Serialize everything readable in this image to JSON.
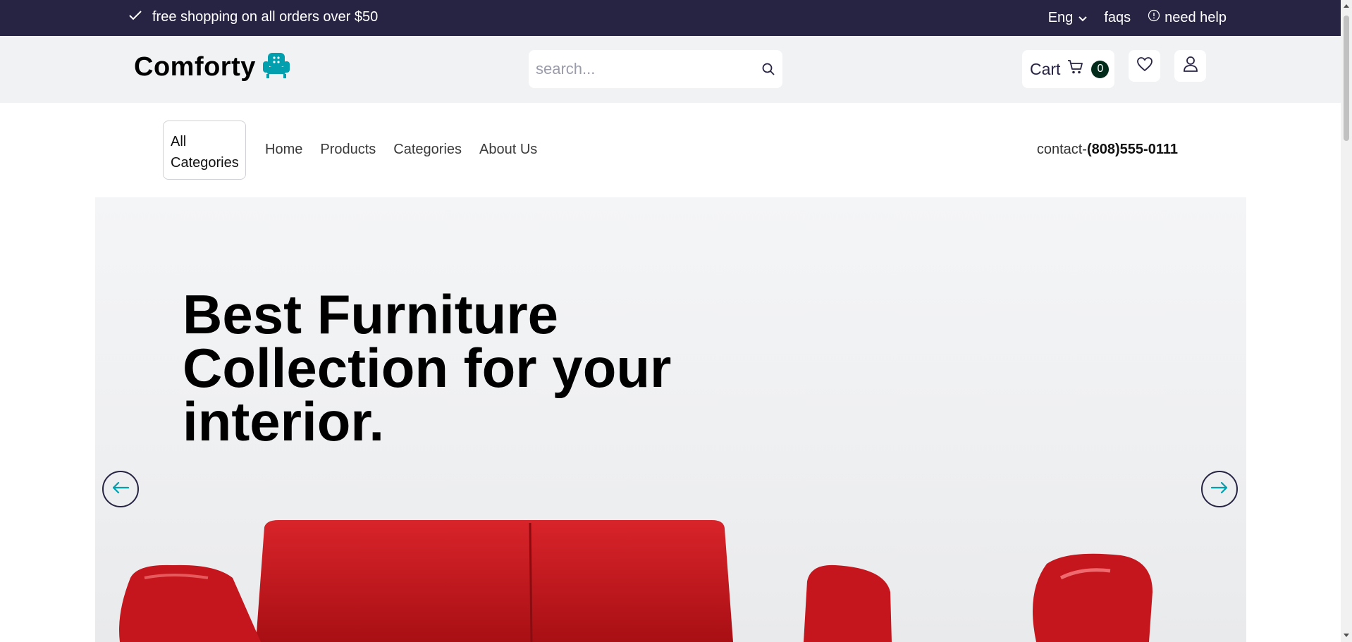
{
  "topbar": {
    "promo": "free shopping on all orders over $50",
    "language": "Eng",
    "faqs": "faqs",
    "help": "need help"
  },
  "header": {
    "logo": "Comforty",
    "search_placeholder": "search...",
    "cart_label": "Cart",
    "cart_count": "0"
  },
  "nav": {
    "all_categories_line1": "All",
    "all_categories_line2": "Categories",
    "items": [
      "Home",
      "Products",
      "Categories",
      "About Us"
    ],
    "contact_label": "contact-",
    "contact_phone": "(808)555-0111"
  },
  "hero": {
    "headline_line1": "Best Furniture",
    "headline_line2": "Collection for your",
    "headline_line3": "interior."
  },
  "colors": {
    "topbar": "#272343",
    "header_bg": "#f0f2f3",
    "accent": "#029fae",
    "badge": "#022b1c",
    "sofa": "#c4161c"
  }
}
